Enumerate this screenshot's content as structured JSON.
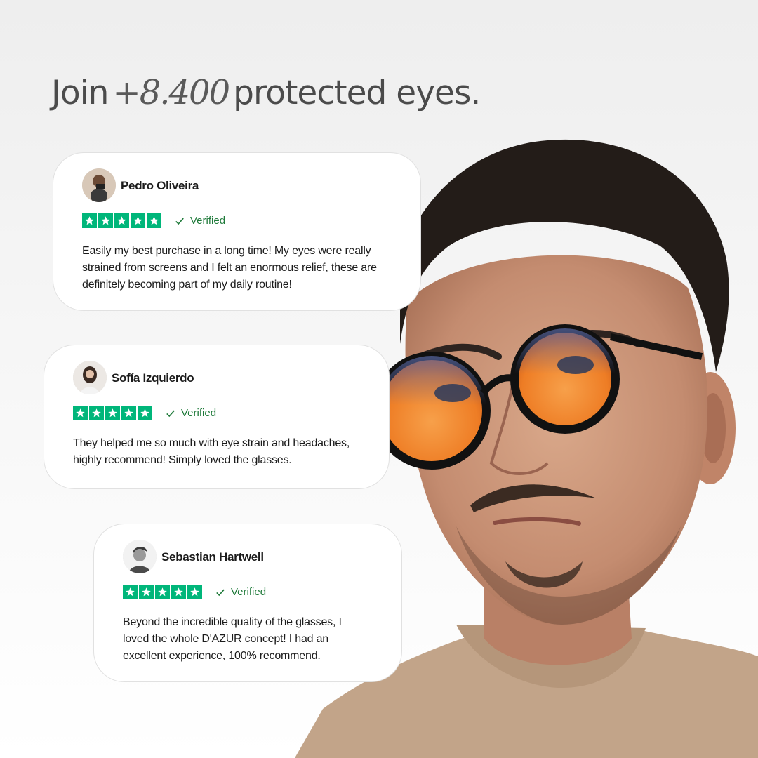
{
  "headline": {
    "prefix": "Join",
    "count": "+8.400",
    "suffix": "protected eyes."
  },
  "colors": {
    "star_green": "#00b67a",
    "verified_green": "#1f7a3a",
    "lens_orange": "#f0862a",
    "sweater": "#c2a489"
  },
  "reviews": [
    {
      "name": "Pedro Oliveira",
      "rating": 5,
      "verified_label": "Verified",
      "text": "Easily my best purchase in a long time! My eyes were really strained from screens and I felt an enormous relief, these are definitely becoming part of my daily routine!"
    },
    {
      "name": "Sofía Izquierdo",
      "rating": 5,
      "verified_label": "Verified",
      "text": "They helped me so much with eye strain and headaches, highly recommend! Simply loved the glasses."
    },
    {
      "name": "Sebastian Hartwell",
      "rating": 5,
      "verified_label": "Verified",
      "text": "Beyond the incredible quality of the glasses, I loved the whole D'AZUR concept! I had an excellent experience, 100% recommend."
    }
  ]
}
